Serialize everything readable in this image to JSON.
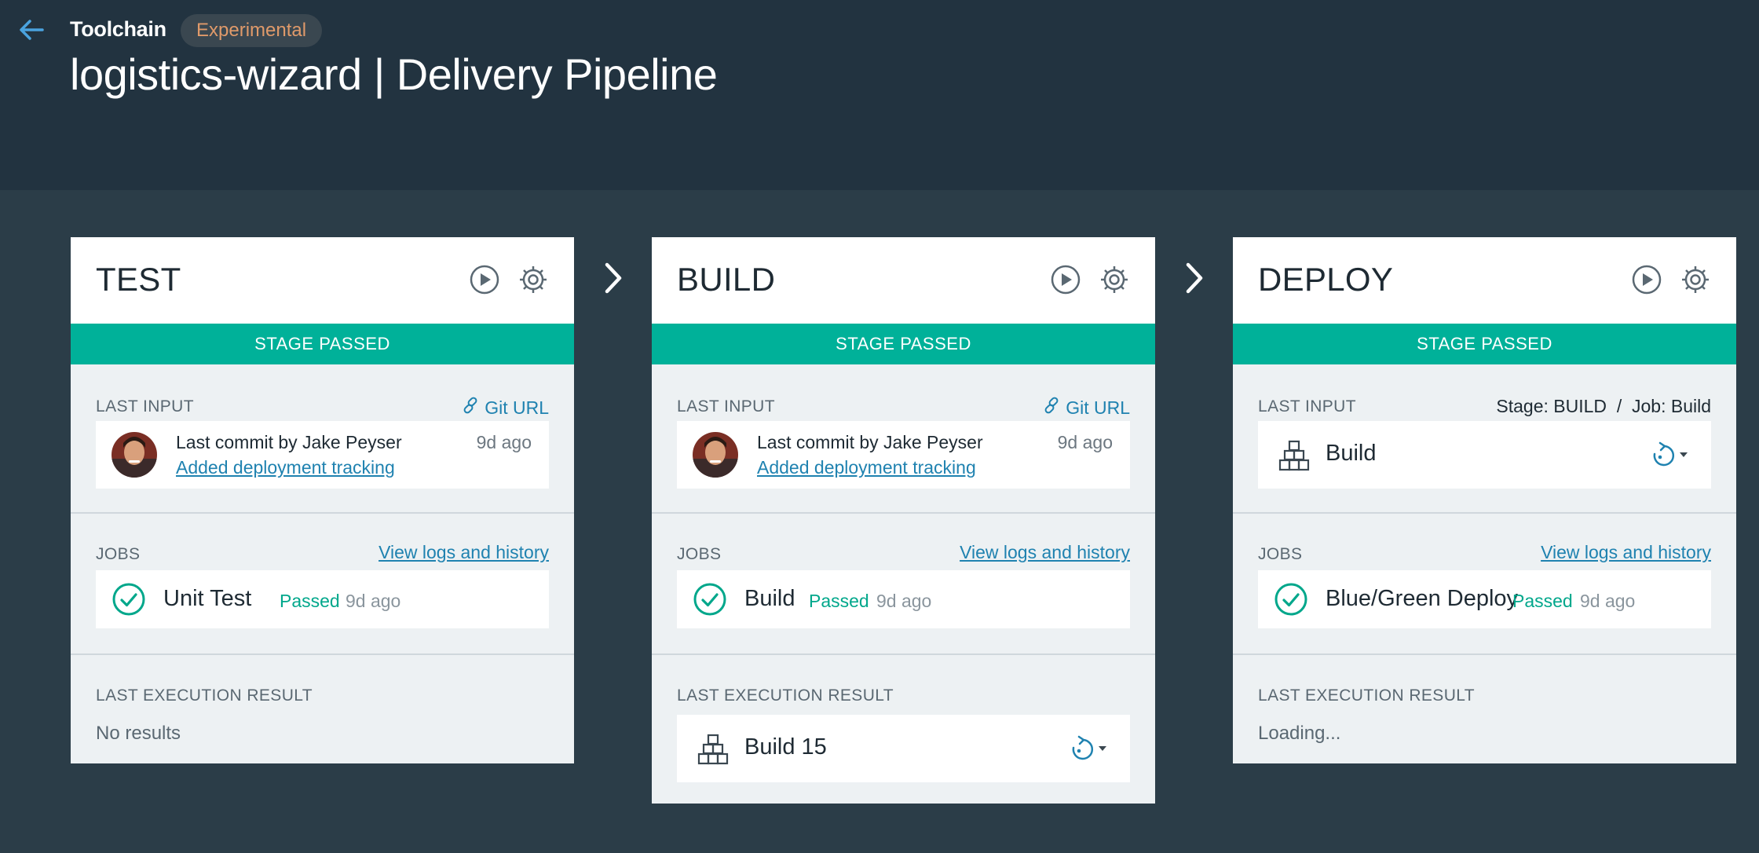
{
  "header": {
    "breadcrumb": "Toolchain",
    "badge": "Experimental",
    "title": "logistics-wizard | Delivery Pipeline"
  },
  "colors": {
    "accent_green": "#00b199",
    "link_blue": "#1f82b0",
    "header_bg": "#223340",
    "page_bg": "#2b3d48"
  },
  "icons": [
    "back-arrow-icon",
    "play-icon",
    "gear-icon",
    "link-icon",
    "check-circle-icon",
    "blocks-icon",
    "redeploy-icon",
    "chevron-right-icon"
  ],
  "stages": [
    {
      "name": "TEST",
      "status": "STAGE PASSED",
      "last_input_label": "LAST INPUT",
      "input_link": "Git URL",
      "commit_by": "Last commit by Jake Peyser",
      "commit_msg": "Added deployment tracking",
      "commit_age": "9d ago",
      "jobs_label": "JOBS",
      "jobs_link": "View logs and history",
      "job_name": "Unit Test",
      "job_status": "Passed",
      "job_age": "9d ago",
      "result_label": "LAST EXECUTION RESULT",
      "result_text": "No results"
    },
    {
      "name": "BUILD",
      "status": "STAGE PASSED",
      "last_input_label": "LAST INPUT",
      "input_link": "Git URL",
      "commit_by": "Last commit by Jake Peyser",
      "commit_msg": "Added deployment tracking",
      "commit_age": "9d ago",
      "jobs_label": "JOBS",
      "jobs_link": "View logs and history",
      "job_name": "Build",
      "job_status": "Passed",
      "job_age": "9d ago",
      "result_label": "LAST EXECUTION RESULT",
      "result_artifact": "Build 15"
    },
    {
      "name": "DEPLOY",
      "status": "STAGE PASSED",
      "last_input_label": "LAST INPUT",
      "input_source": "Stage: BUILD  /  Job: Build",
      "input_artifact": "Build",
      "jobs_label": "JOBS",
      "jobs_link": "View logs and history",
      "job_name": "Blue/Green Deploy",
      "job_status": "Passed",
      "job_age": "9d ago",
      "result_label": "LAST EXECUTION RESULT",
      "result_text": "Loading..."
    }
  ]
}
